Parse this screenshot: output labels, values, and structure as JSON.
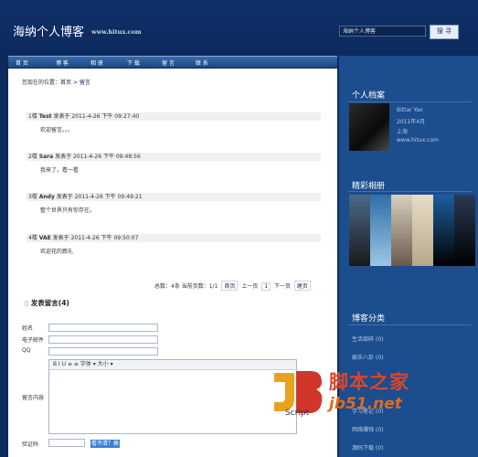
{
  "header": {
    "title": "海纳个人博客",
    "url": "www.hitux.com",
    "search_value": "海纳个人博客",
    "search_button": "搜 寻"
  },
  "nav": [
    "首 页",
    "博 客",
    "相 册",
    "下 载",
    "留 言",
    "联 系"
  ],
  "breadcrumb": {
    "prefix": "您现在的位置：",
    "home": "首页",
    "sep": " > ",
    "current": "留言"
  },
  "comments": [
    {
      "num": "1楼",
      "name": "Test",
      "label": "发表于",
      "time": "2011-4-26 下午 09:27:40",
      "body": "欢迎留言。。。"
    },
    {
      "num": "2楼",
      "name": "Sara",
      "label": "发表于",
      "time": "2011-4-26 下午 09:48:56",
      "body": "我来了，看一看"
    },
    {
      "num": "3楼",
      "name": "Andy",
      "label": "发表于",
      "time": "2011-4-26 下午 09:49:21",
      "body": "整个世界只有你存在。"
    },
    {
      "num": "4楼",
      "name": "VAE",
      "label": "发表于",
      "time": "2011-4-26 下午 09:50:07",
      "body": "欢迎花的葬礼"
    }
  ],
  "pager": {
    "summary": "总数：4条 当前页数：1/1",
    "first": "首页",
    "prev": "上一页",
    "page": "1",
    "next": "下一页",
    "last": "尾页"
  },
  "form": {
    "title": "发表留言(4)",
    "name_label": "姓名",
    "email_label": "电子邮件",
    "qq_label": "QQ",
    "content_label": "留言内容",
    "captcha_label": "验证码",
    "toolbar": "B  I  U  ≡  ≡  字体 ▾  大小 ▾",
    "captcha_text": "看不清？换一张"
  },
  "sidebar": {
    "profile_title": "个人档案",
    "profile": [
      "Bittar Yao",
      "2011年4月",
      "上海",
      "www.hitux.com"
    ],
    "album_title": "精彩相册",
    "category_title": "博客分类",
    "categories": [
      "生活琐碎 (0)",
      "娱乐八卦 (0)",
      "学习笔记 (0)",
      "网络赚钱 (0)",
      "源码下载 (0)"
    ]
  },
  "watermark": {
    "cn": "脚本之家",
    "url": "jb51.net",
    "script": "Script"
  },
  "colors": {
    "page_bg": "#0d2a5c",
    "sidebar_bg": "#1c4d8e",
    "nav": "#2a5a9a"
  }
}
